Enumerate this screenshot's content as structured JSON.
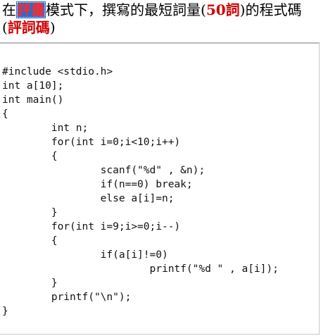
{
  "header": {
    "prefix": "在",
    "highlight": "評量",
    "middle": "模式下，撰寫的最短詞量(",
    "count": "50詞",
    "suffix": ")的程式碼(",
    "tail": "評詞碼",
    "close": ")"
  },
  "code_lines": [
    "#include <stdio.h>",
    "int a[10];",
    "int main()",
    "{",
    "\tint n;",
    "\tfor(int i=0;i<10;i++)",
    "\t{",
    "\t\tscanf(\"%d\" , &n);",
    "\t\tif(n==0) break;",
    "\t\telse a[i]=n;",
    "\t}",
    "\tfor(int i=9;i>=0;i--)",
    "\t{",
    "\t\tif(a[i]!=0)",
    "\t\t\tprintf(\"%d \" , a[i]);",
    "\t}",
    "\tprintf(\"\\n\");",
    "}"
  ]
}
